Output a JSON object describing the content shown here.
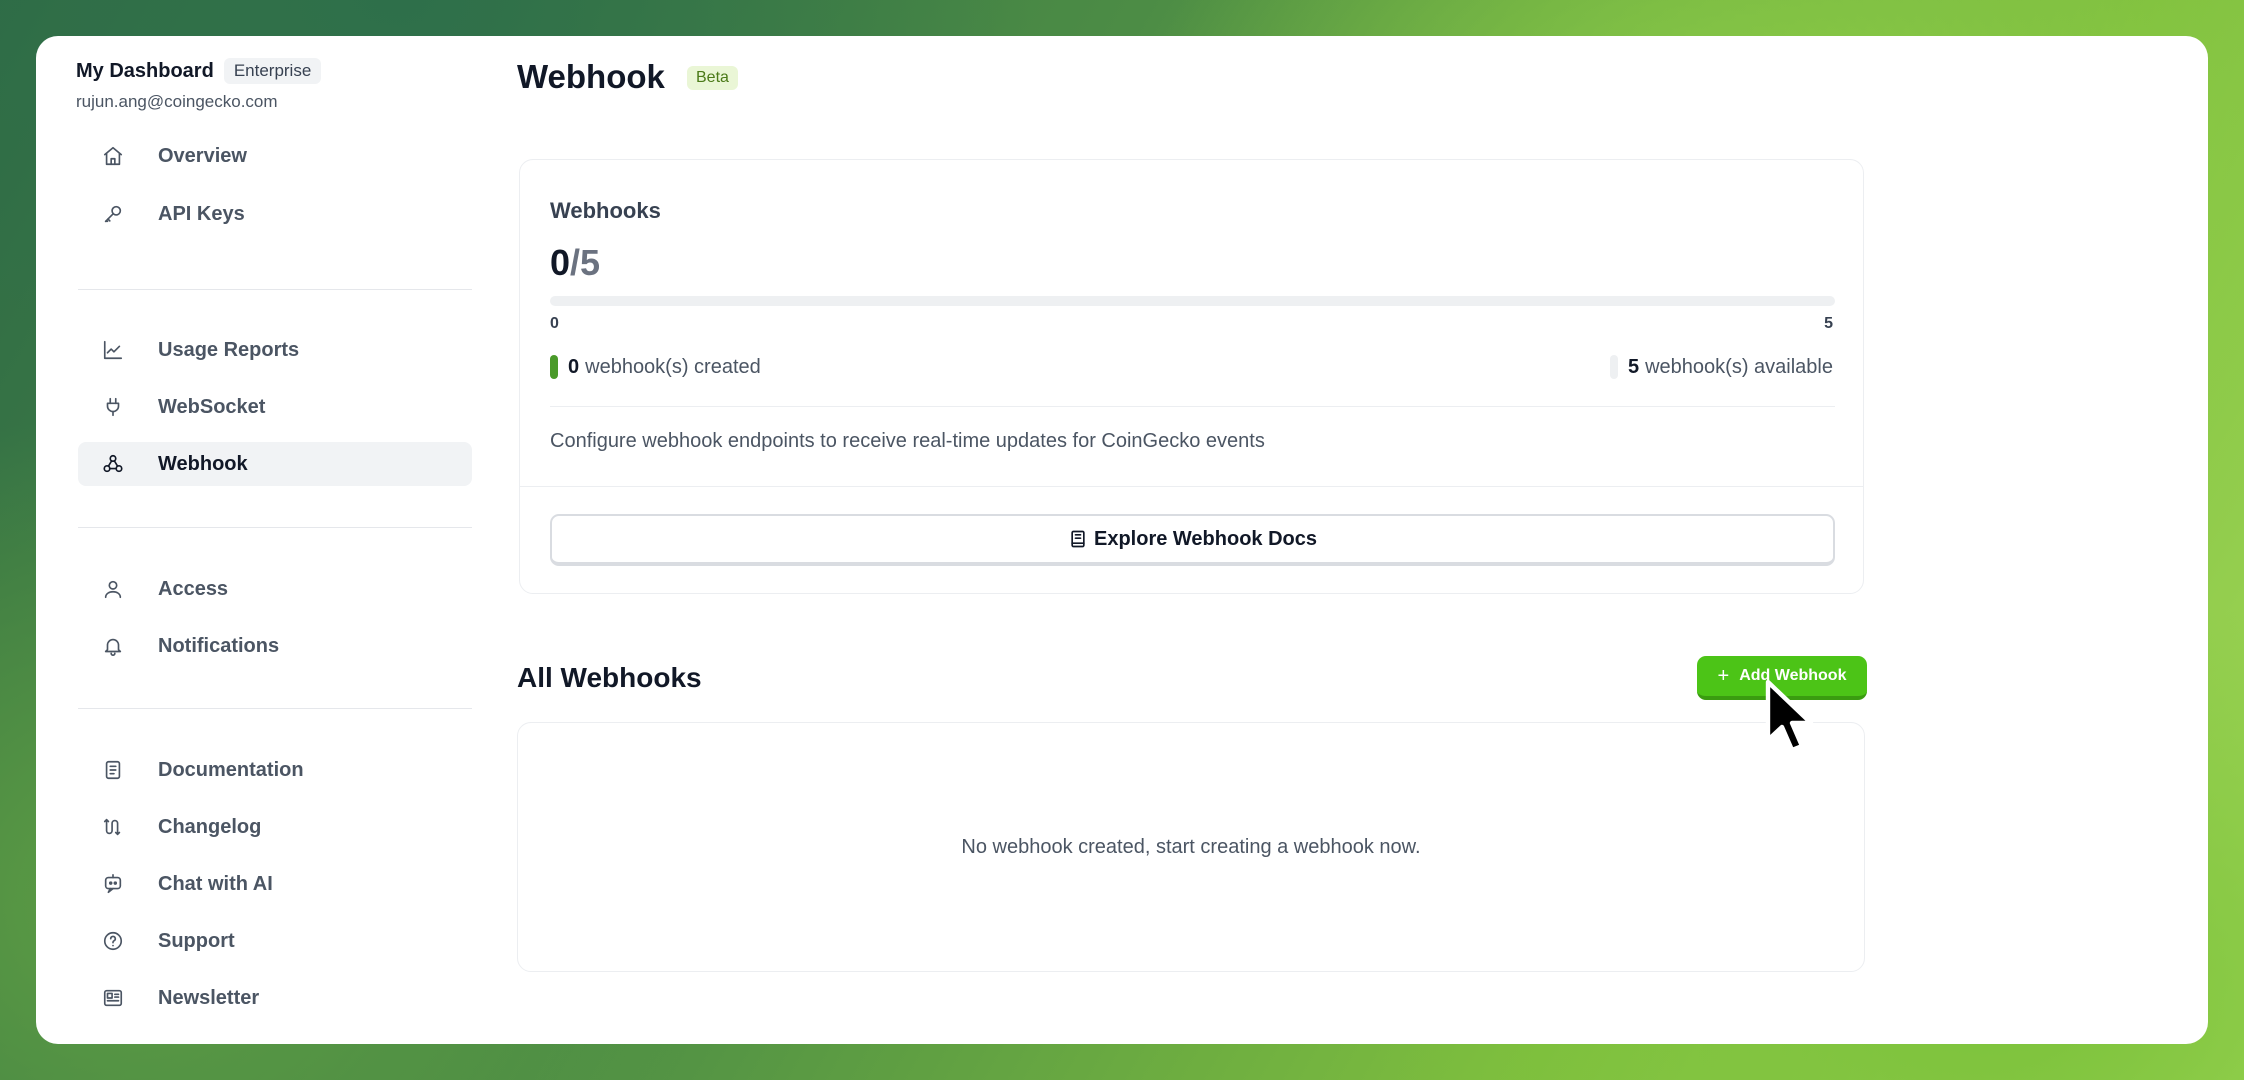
{
  "sidebar": {
    "title": "My Dashboard",
    "plan_badge": "Enterprise",
    "email": "rujun.ang@coingecko.com",
    "groups": [
      [
        {
          "label": "Overview",
          "icon": "home-icon"
        },
        {
          "label": "API Keys",
          "icon": "key-icon"
        }
      ],
      [
        {
          "label": "Usage Reports",
          "icon": "chart-line-icon"
        },
        {
          "label": "WebSocket",
          "icon": "plug-icon"
        },
        {
          "label": "Webhook",
          "icon": "webhook-icon",
          "active": true
        }
      ],
      [
        {
          "label": "Access",
          "icon": "user-icon"
        },
        {
          "label": "Notifications",
          "icon": "bell-icon"
        }
      ],
      [
        {
          "label": "Documentation",
          "icon": "document-icon"
        },
        {
          "label": "Changelog",
          "icon": "changelog-icon"
        },
        {
          "label": "Chat with AI",
          "icon": "chat-bot-icon"
        },
        {
          "label": "Support",
          "icon": "help-circle-icon"
        },
        {
          "label": "Newsletter",
          "icon": "newspaper-icon"
        }
      ]
    ]
  },
  "page": {
    "title": "Webhook",
    "badge": "Beta"
  },
  "summary": {
    "label": "Webhooks",
    "used": "0",
    "limit": "/5",
    "progress_fraction": 0,
    "tick_min": "0",
    "tick_max": "5",
    "created_count": "0",
    "created_label": "webhook(s) created",
    "available_count": "5",
    "available_label": "webhook(s) available",
    "description": "Configure webhook endpoints to receive real-time updates for CoinGecko events",
    "docs_button": "Explore Webhook Docs"
  },
  "all_webhooks": {
    "title": "All Webhooks",
    "add_button": "Add Webhook",
    "empty_message": "No webhook created, start creating a webhook now."
  },
  "colors": {
    "accent_green": "#4cc417",
    "progress_green": "#4a9a2a",
    "beta_badge_bg": "#eaf6d6"
  }
}
